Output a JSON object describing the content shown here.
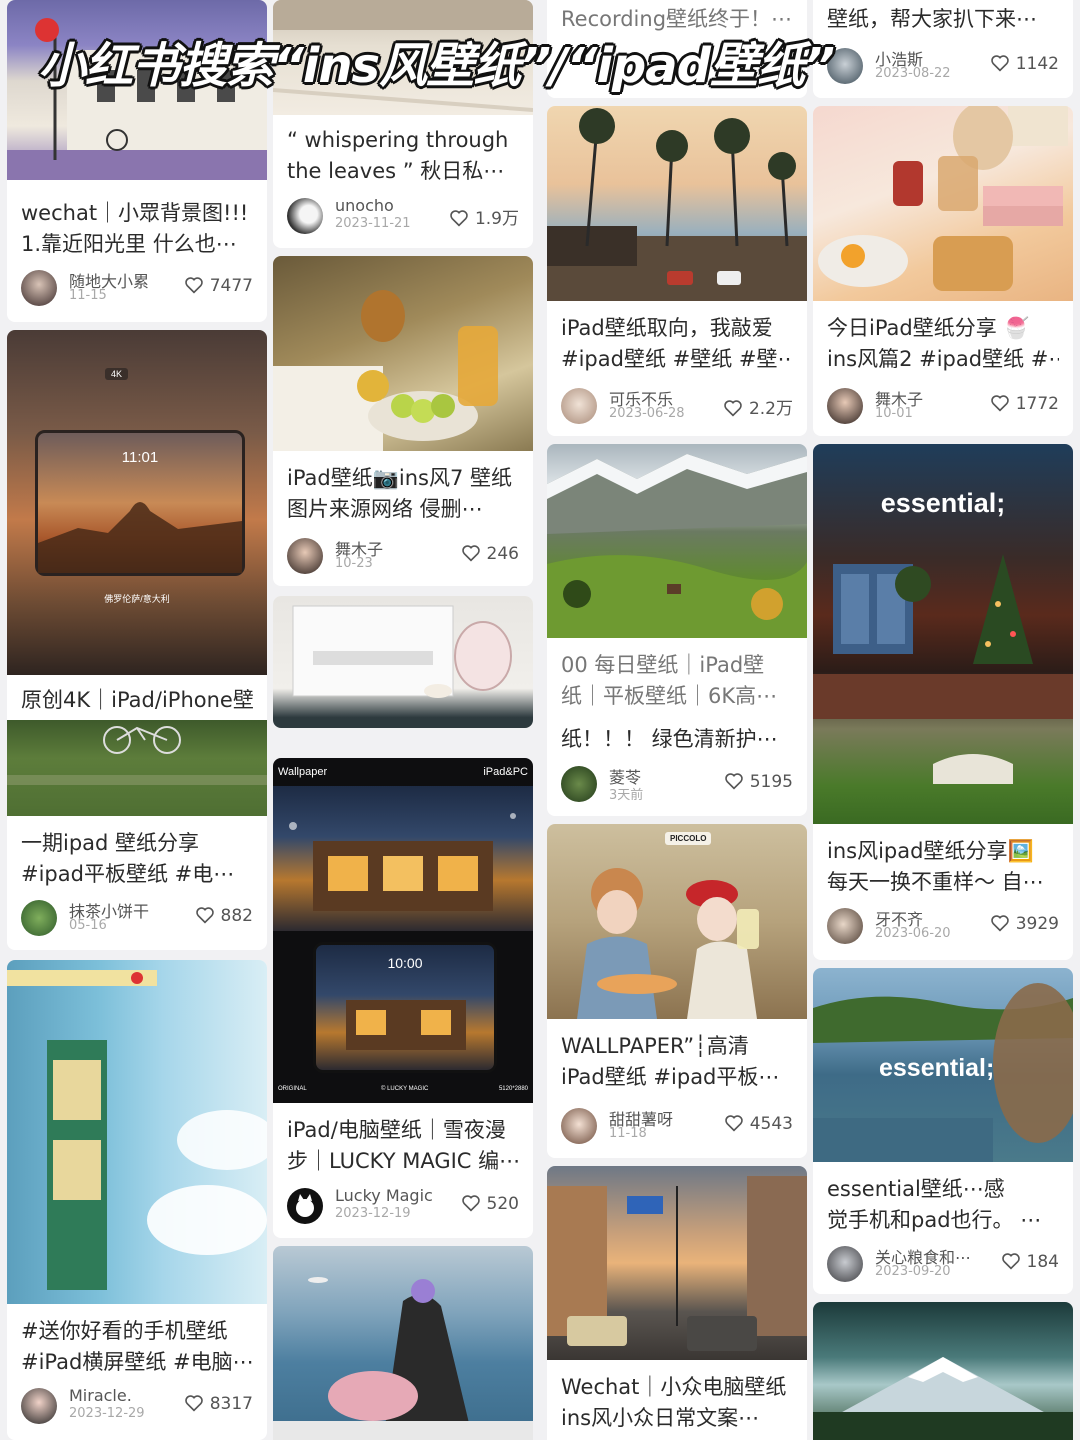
{
  "banner": "小红书搜索“ins风壁纸”/“ipad壁纸”",
  "col1": [
    {
      "title1": "wechat｜小眾背景图!!!",
      "title2": "1.靠近阳光里 什么也⋯",
      "author": "随地大小累",
      "date": "11-15",
      "likes": "7477"
    },
    {
      "title1": "原创4K｜iPad/iPhone壁",
      "overlay_badge": "4K",
      "overlay_time": "11:01",
      "overlay_place": "佛罗伦萨/意大利"
    },
    {
      "title1": "一期ipad 壁纸分享",
      "title2": "#ipad平板壁纸 #电⋯",
      "author": "抹茶小饼干",
      "date": "05-16",
      "likes": "882"
    },
    {
      "title1": "#送你好看的手机壁纸",
      "title2": "#iPad横屏壁纸 #电脑⋯",
      "author": "Miracle.",
      "date": "2023-12-29",
      "likes": "8317"
    }
  ],
  "col2": [
    {
      "title1": "“ whispering through",
      "title2": "the leaves ” 秋日私⋯",
      "author": "unocho",
      "date": "2023-11-21",
      "likes": "1.9万"
    },
    {
      "title1": "iPad壁纸📷ins风7 壁纸",
      "title2": "图片来源网络 侵删⋯",
      "author": "舞木子",
      "date": "10-23",
      "likes": "246"
    },
    {
      "title1": "",
      "overlay_left": "Wallpaper",
      "overlay_right": "iPad&PC",
      "overlay_time": "10:00",
      "overlay_bl": "ORIGINAL",
      "overlay_bm": "© LUCKY MAGIC",
      "overlay_br": "5120*2880"
    },
    {
      "title1": "iPad/电脑壁纸｜雪夜漫",
      "title2": "步｜LUCKY MAGIC 编⋯",
      "author": "Lucky Magic",
      "date": "2023-12-19",
      "likes": "520"
    }
  ],
  "col3": [
    {
      "title1": "Recording壁纸终于！⋯",
      "title2": ""
    },
    {
      "title1": "iPad壁纸取向，我敲爱",
      "title2": "#ipad壁纸 #壁纸 #壁⋯",
      "author": "可乐不乐",
      "date": "2023-06-28",
      "likes": "2.2万"
    },
    {
      "title1": "00 每日壁纸｜iPad壁",
      "title2": "纸｜平板壁纸｜6K高⋯",
      "title3": "纸！！！ 绿色清新护⋯",
      "author": "菱苓",
      "date": "3天前",
      "likes": "5195"
    },
    {
      "title1": "WALLPAPER”┆高清",
      "title2": "iPad壁纸 #ipad平板⋯",
      "author": "甜甜薯呀",
      "date": "11-18",
      "likes": "4543",
      "overlay_sign": "PICCOLO"
    },
    {
      "title1": "Wechat｜小众电脑壁纸",
      "title2": "ins风小众日常文案⋯"
    }
  ],
  "col4": [
    {
      "title1": "壁纸，帮大家扒下来⋯",
      "author": "小浩斯",
      "date": "2023-08-22",
      "likes": "1142"
    },
    {
      "title1": "今日iPad壁纸分享 🍧",
      "title2": "ins风篇2 #ipad壁纸 #⋯",
      "author": "舞木子",
      "date": "10-01",
      "likes": "1772"
    },
    {
      "title1": "ins风ipad壁纸分享🖼️",
      "title2": "每天一换不重样～ 自⋯",
      "author": "牙不齐",
      "date": "2023-06-20",
      "likes": "3929",
      "overlay_text": "essential;"
    },
    {
      "title1": "essential壁纸⋯感",
      "title2": "觉手机和pad也行。 ⋯",
      "author": "关心粮食和⋯",
      "date": "2023-09-20",
      "likes": "184",
      "overlay_text": "essential;"
    },
    {
      "title1": ""
    }
  ]
}
